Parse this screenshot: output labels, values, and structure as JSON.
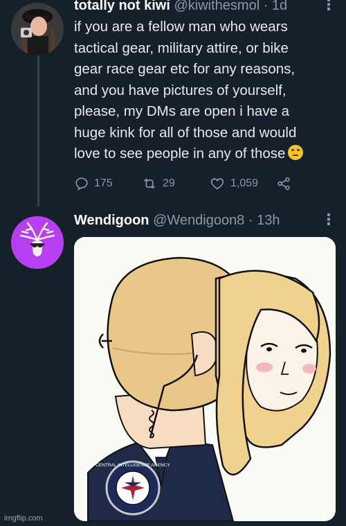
{
  "tweet1": {
    "display_name": "totally not kiwi",
    "handle": "@kiwithesmol",
    "time": "· 1d",
    "text_lines": [
      "if you are a fellow man who wears",
      "tactical gear, military attire, or bike",
      "gear race gear etc for any reasons,",
      "and you have pictures of yourself,",
      "please, my DMs are open i have a",
      "huge kink for all of those and would",
      "love to see people in any of those"
    ],
    "replies": "175",
    "retweets": "29",
    "likes": "1,059"
  },
  "tweet2": {
    "display_name": "Wendigoon",
    "handle": "@Wendigoon8",
    "time": "· 13h",
    "media": {
      "seal_text": "CENTRAL INTELLIGENCE AGENCY",
      "seal_initials": "CIA"
    }
  },
  "icons": {
    "more": "more-dots-icon",
    "reply": "reply-icon",
    "retweet": "retweet-icon",
    "like": "heart-icon",
    "share": "share-icon",
    "emoji": "rolling-eyes-emoji-icon"
  },
  "colors": {
    "background": "#15202b",
    "text": "#e7e9ea",
    "secondary": "#8b98a5",
    "avatar2": "#b640f0"
  },
  "watermark": "imgflip.com"
}
